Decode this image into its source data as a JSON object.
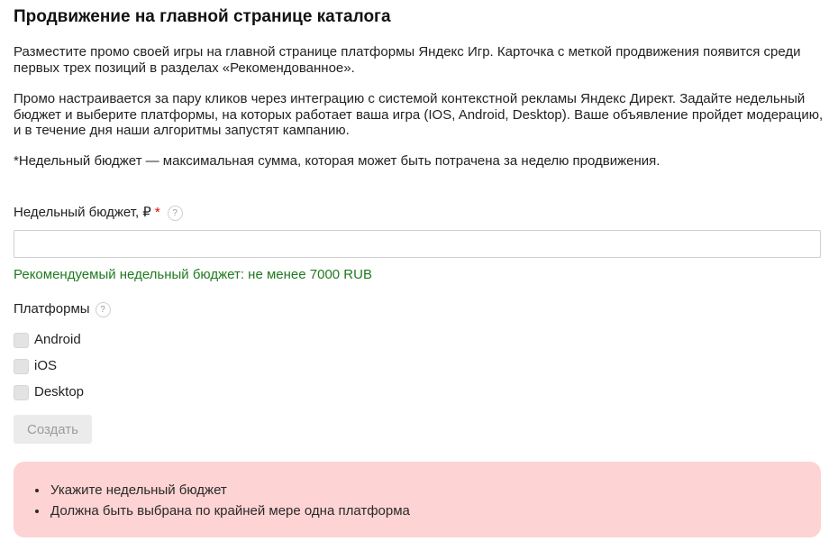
{
  "page": {
    "title": "Продвижение на главной странице каталога",
    "paragraphs": [
      "Разместите промо своей игры на главной странице платформы Яндекс Игр. Карточка с меткой продвижения появится среди первых трех позиций в разделах «Рекомендованное».",
      "Промо настраивается за пару кликов через интеграцию с системой контекстной рекламы Яндекс Директ. Задайте недельный бюджет и выберите платформы, на которых работает ваша игра (IOS, Android, Desktop). Ваше объявление пройдет модерацию, и в течение дня наши алгоритмы запустят кампанию.",
      "*Недельный бюджет — максимальная сумма, которая может быть потрачена за неделю продвижения."
    ]
  },
  "budget": {
    "label": "Недельный бюджет, ₽",
    "required_mark": "*",
    "help_icon": "?",
    "value": "",
    "placeholder": "",
    "hint": "Рекомендуемый недельный бюджет: не менее 7000 RUB"
  },
  "platforms": {
    "label": "Платформы",
    "help_icon": "?",
    "options": [
      {
        "label": "Android",
        "checked": false
      },
      {
        "label": "iOS",
        "checked": false
      },
      {
        "label": "Desktop",
        "checked": false
      }
    ]
  },
  "actions": {
    "create_label": "Создать"
  },
  "errors": [
    "Укажите недельный бюджет",
    "Должна быть выбрана по крайней мере одна платформа"
  ],
  "colors": {
    "hint_green": "#1f7a1f",
    "required_red": "#e60000",
    "error_bg": "#fdd3d3",
    "disabled_button_bg": "#ebebeb"
  }
}
